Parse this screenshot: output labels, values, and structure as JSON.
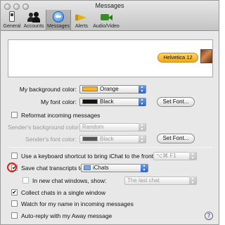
{
  "window": {
    "title": "Messages"
  },
  "toolbar": {
    "items": [
      {
        "label": "General",
        "icon": "general-switch-icon"
      },
      {
        "label": "Accounts",
        "icon": "accounts-people-icon"
      },
      {
        "label": "Messages",
        "icon": "messages-globe-icon",
        "selected": true
      },
      {
        "label": "Alerts",
        "icon": "alerts-megaphone-icon"
      },
      {
        "label": "Audio/Video",
        "icon": "audio-video-camera-icon"
      }
    ]
  },
  "preview": {
    "bubble_text": "Helvetica 12"
  },
  "colors": {
    "my_background": {
      "label": "My background color:",
      "value": "Orange",
      "swatch": "#f6b332"
    },
    "my_font": {
      "label": "My font color:",
      "value": "Black",
      "swatch": "#111111",
      "button": "Set Font..."
    }
  },
  "reformat": {
    "label": "Reformat incoming messages",
    "checked": false,
    "sender_background": {
      "label": "Sender's background color:",
      "value": "Random"
    },
    "sender_font": {
      "label": "Sender's font color:",
      "value": "Black",
      "swatch": "#111111",
      "button": "Set Font..."
    }
  },
  "options": {
    "keyboard_shortcut": {
      "label": "Use a keyboard shortcut to bring iChat to the front:",
      "value": "⌥⌘ F1",
      "checked": false
    },
    "save_transcripts": {
      "label": "Save chat transcripts to:",
      "value": "iChats",
      "checked": true
    },
    "new_windows": {
      "label": "In new chat windows, show:",
      "value": "The last chat",
      "checked": false
    },
    "collect_chats": {
      "label": "Collect chats in a single window",
      "checked": true
    },
    "watch_name": {
      "label": "Watch for my name in incoming messages",
      "checked": false
    },
    "auto_reply": {
      "label": "Auto-reply with my Away message",
      "checked": false
    }
  },
  "help": {
    "label": "?"
  }
}
